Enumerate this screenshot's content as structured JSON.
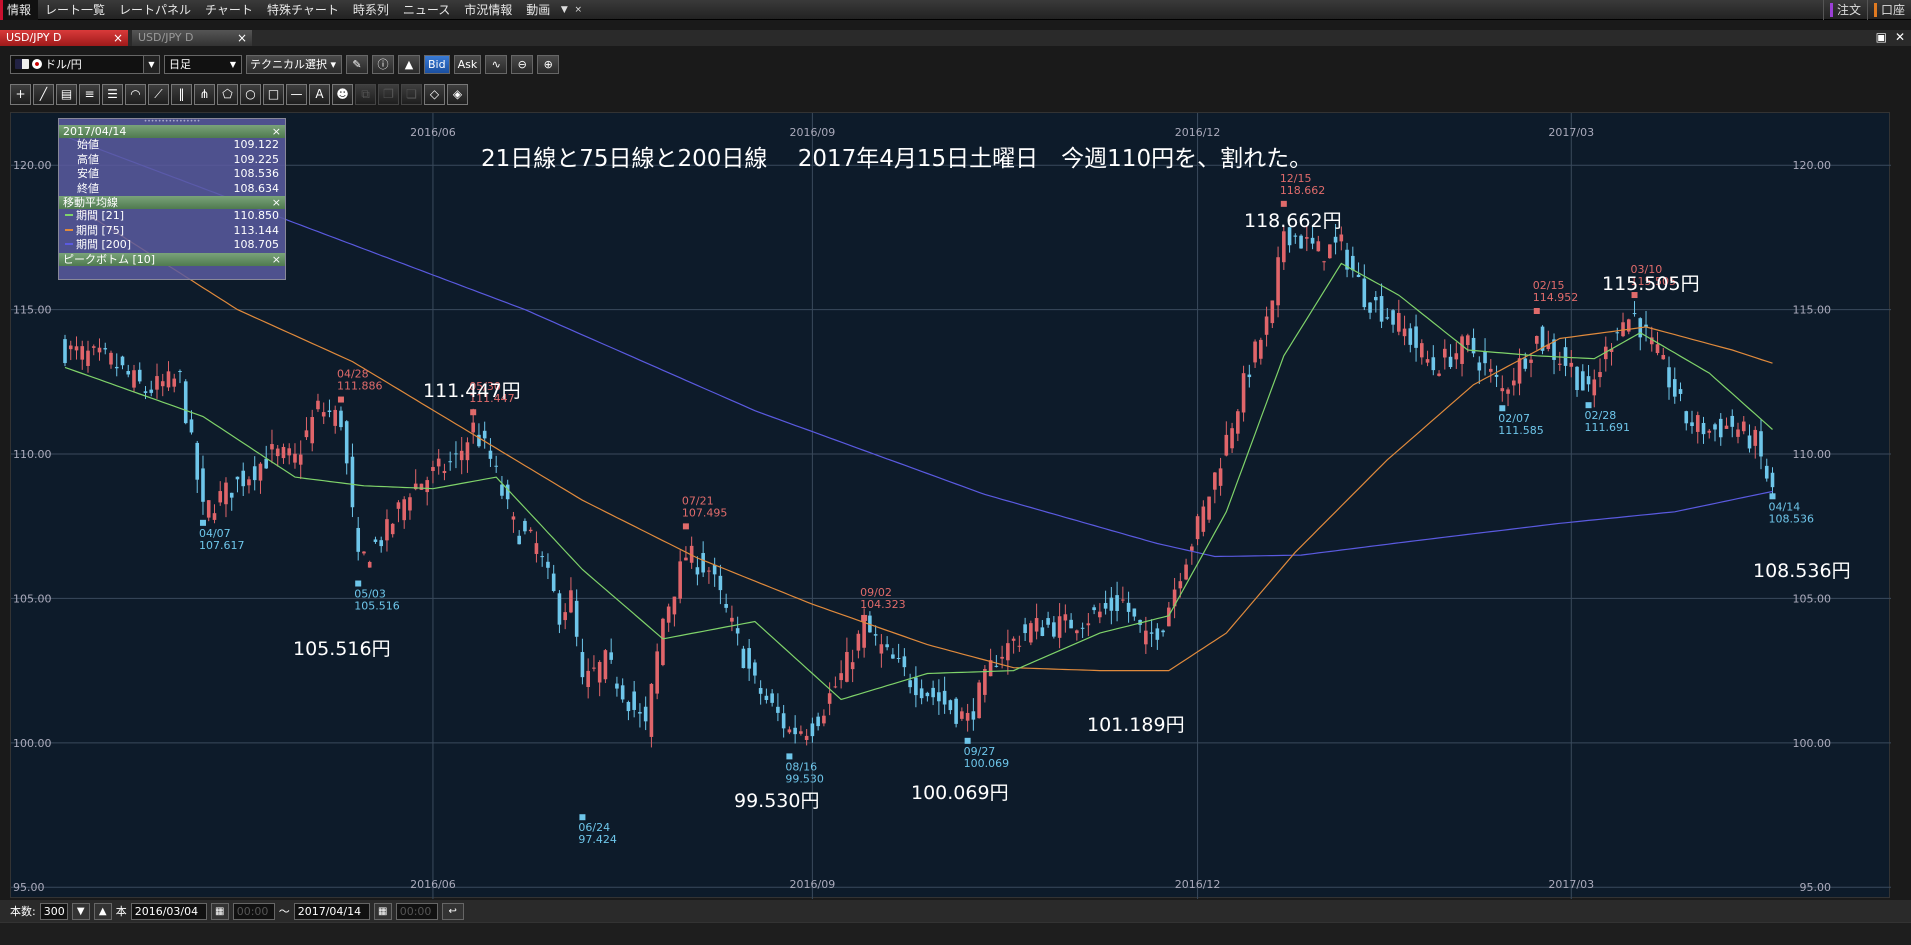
{
  "menu": {
    "items": [
      "情報",
      "レート一覧",
      "レートパネル",
      "チャート",
      "特殊チャート",
      "時系列",
      "ニュース",
      "市況情報",
      "動画"
    ],
    "right": [
      "注文",
      "口座"
    ]
  },
  "tabs": [
    {
      "label": "USD/JPY D",
      "active": true
    },
    {
      "label": "USD/JPY D",
      "active": false
    }
  ],
  "toolbar": {
    "pair": "ドル/円",
    "timeframe": "日足",
    "technical": "テクニカル選択",
    "bid": "Bid",
    "ask": "Ask"
  },
  "info_panel": {
    "date": "2017/04/14",
    "ohlc": [
      {
        "label": "始値",
        "value": "109.122"
      },
      {
        "label": "高値",
        "value": "109.225"
      },
      {
        "label": "安値",
        "value": "108.536"
      },
      {
        "label": "終値",
        "value": "108.634"
      }
    ],
    "ma_title": "移動平均線",
    "ma": [
      {
        "label": "期間 [21]",
        "value": "110.850",
        "color": "#7fd36a"
      },
      {
        "label": "期間 [75]",
        "value": "113.144",
        "color": "#e08a3c"
      },
      {
        "label": "期間 [200]",
        "value": "108.705",
        "color": "#5a5ae0"
      }
    ],
    "peak_title": "ピークボトム [10]"
  },
  "chart_data": {
    "type": "candlestick",
    "title": "21日線と75日線と200日線　 2017年4月15日土曜日　今週110円を、割れた。",
    "x_tick_labels": [
      "2016/06",
      "2016/09",
      "2016/12",
      "2017/03"
    ],
    "y_ticks": [
      "95.00",
      "100.00",
      "105.00",
      "110.00",
      "115.00",
      "120.00"
    ],
    "ylim": [
      94.8,
      121.6
    ],
    "colors": {
      "up": "#e0656a",
      "down": "#6ec6ea",
      "ma21": "#7fd36a",
      "ma75": "#e08a3c",
      "ma200": "#5a5ae0"
    },
    "peaks": [
      {
        "date": "04/28",
        "value": "111.886",
        "type": "high",
        "i": 48
      },
      {
        "date": "05/30",
        "value": "111.447",
        "type": "high",
        "i": 71
      },
      {
        "date": "07/21",
        "value": "107.495",
        "type": "high",
        "i": 108
      },
      {
        "date": "09/02",
        "value": "104.323",
        "type": "high",
        "i": 139
      },
      {
        "date": "12/15",
        "value": "118.662",
        "type": "high",
        "i": 212
      },
      {
        "date": "02/15",
        "value": "114.952",
        "type": "high",
        "i": 256
      },
      {
        "date": "03/10",
        "value": "115.505",
        "type": "high",
        "i": 273
      },
      {
        "date": "04/07",
        "value": "107.617",
        "type": "low",
        "i": 24
      },
      {
        "date": "05/03",
        "value": "105.516",
        "type": "low",
        "i": 51
      },
      {
        "date": "06/24",
        "value": "97.424",
        "type": "low",
        "i": 90
      },
      {
        "date": "08/16",
        "value": "99.530",
        "type": "low",
        "i": 126
      },
      {
        "date": "09/27",
        "value": "100.069",
        "type": "low",
        "i": 157
      },
      {
        "date": "02/07",
        "value": "111.585",
        "type": "low",
        "i": 250
      },
      {
        "date": "02/28",
        "value": "111.691",
        "type": "low",
        "i": 265
      },
      {
        "date": "04/14",
        "value": "108.536",
        "type": "low",
        "i": 297
      }
    ],
    "annotations": [
      "111.447円",
      "105.516円",
      "99.530円",
      "100.069円",
      "101.189円",
      "118.662円",
      "115.505円",
      "108.536円"
    ],
    "close_path": [
      [
        0,
        113.6
      ],
      [
        8,
        113.2
      ],
      [
        14,
        112.2
      ],
      [
        20,
        112.6
      ],
      [
        24,
        108.0
      ],
      [
        30,
        109.0
      ],
      [
        36,
        110.0
      ],
      [
        40,
        109.8
      ],
      [
        44,
        111.6
      ],
      [
        48,
        111.2
      ],
      [
        51,
        106.2
      ],
      [
        56,
        107.3
      ],
      [
        60,
        108.8
      ],
      [
        64,
        109.3
      ],
      [
        68,
        109.8
      ],
      [
        71,
        110.9
      ],
      [
        74,
        109.8
      ],
      [
        78,
        107.5
      ],
      [
        82,
        106.8
      ],
      [
        86,
        104.5
      ],
      [
        88,
        105.0
      ],
      [
        90,
        102.0
      ],
      [
        94,
        102.8
      ],
      [
        98,
        101.5
      ],
      [
        101,
        100.5
      ],
      [
        104,
        104.3
      ],
      [
        108,
        106.5
      ],
      [
        112,
        106.0
      ],
      [
        116,
        104.0
      ],
      [
        120,
        102.0
      ],
      [
        126,
        100.4
      ],
      [
        130,
        100.6
      ],
      [
        135,
        102.3
      ],
      [
        139,
        104.0
      ],
      [
        143,
        103.0
      ],
      [
        147,
        102.2
      ],
      [
        152,
        101.5
      ],
      [
        157,
        100.8
      ],
      [
        162,
        103.0
      ],
      [
        168,
        104.0
      ],
      [
        174,
        104.1
      ],
      [
        180,
        104.5
      ],
      [
        184,
        104.9
      ],
      [
        188,
        103.5
      ],
      [
        191,
        104.2
      ],
      [
        194,
        106.0
      ],
      [
        198,
        108.0
      ],
      [
        202,
        110.5
      ],
      [
        206,
        113.0
      ],
      [
        210,
        115.0
      ],
      [
        212,
        117.8
      ],
      [
        218,
        117.0
      ],
      [
        222,
        117.2
      ],
      [
        226,
        115.5
      ],
      [
        232,
        114.5
      ],
      [
        238,
        113.0
      ],
      [
        244,
        113.8
      ],
      [
        250,
        112.2
      ],
      [
        256,
        114.0
      ],
      [
        262,
        113.0
      ],
      [
        265,
        112.0
      ],
      [
        270,
        114.5
      ],
      [
        273,
        114.8
      ],
      [
        278,
        113.0
      ],
      [
        282,
        111.2
      ],
      [
        286,
        110.8
      ],
      [
        290,
        111.0
      ],
      [
        294,
        110.4
      ],
      [
        297,
        108.634
      ]
    ],
    "ma21_path": [
      [
        0,
        113.0
      ],
      [
        24,
        111.3
      ],
      [
        40,
        109.2
      ],
      [
        52,
        108.9
      ],
      [
        64,
        108.8
      ],
      [
        75,
        109.2
      ],
      [
        90,
        106.0
      ],
      [
        104,
        103.6
      ],
      [
        120,
        104.2
      ],
      [
        135,
        101.5
      ],
      [
        150,
        102.4
      ],
      [
        165,
        102.5
      ],
      [
        180,
        103.8
      ],
      [
        192,
        104.4
      ],
      [
        202,
        108.0
      ],
      [
        212,
        113.4
      ],
      [
        222,
        116.6
      ],
      [
        232,
        115.5
      ],
      [
        244,
        113.6
      ],
      [
        256,
        113.4
      ],
      [
        266,
        113.3
      ],
      [
        274,
        114.2
      ],
      [
        286,
        112.8
      ],
      [
        297,
        110.85
      ]
    ],
    "ma75_path": [
      [
        0,
        118.8
      ],
      [
        30,
        115.0
      ],
      [
        50,
        113.2
      ],
      [
        70,
        110.8
      ],
      [
        90,
        108.4
      ],
      [
        110,
        106.4
      ],
      [
        130,
        104.8
      ],
      [
        150,
        103.4
      ],
      [
        165,
        102.6
      ],
      [
        180,
        102.5
      ],
      [
        192,
        102.5
      ],
      [
        202,
        103.8
      ],
      [
        214,
        106.6
      ],
      [
        230,
        109.8
      ],
      [
        245,
        112.4
      ],
      [
        260,
        114.0
      ],
      [
        275,
        114.4
      ],
      [
        290,
        113.6
      ],
      [
        297,
        113.144
      ]
    ],
    "ma200_path": [
      [
        0,
        121.0
      ],
      [
        40,
        118.0
      ],
      [
        80,
        115.0
      ],
      [
        120,
        111.5
      ],
      [
        160,
        108.6
      ],
      [
        190,
        106.9
      ],
      [
        200,
        106.45
      ],
      [
        215,
        106.5
      ],
      [
        235,
        107.0
      ],
      [
        260,
        107.6
      ],
      [
        280,
        108.0
      ],
      [
        297,
        108.705
      ]
    ]
  },
  "bottom": {
    "count_label": "本数:",
    "count": "300",
    "unit": "本",
    "from_date": "2016/03/04",
    "from_time": "00:00",
    "tilde": "～",
    "to_date": "2017/04/14",
    "to_time": "00:00"
  }
}
